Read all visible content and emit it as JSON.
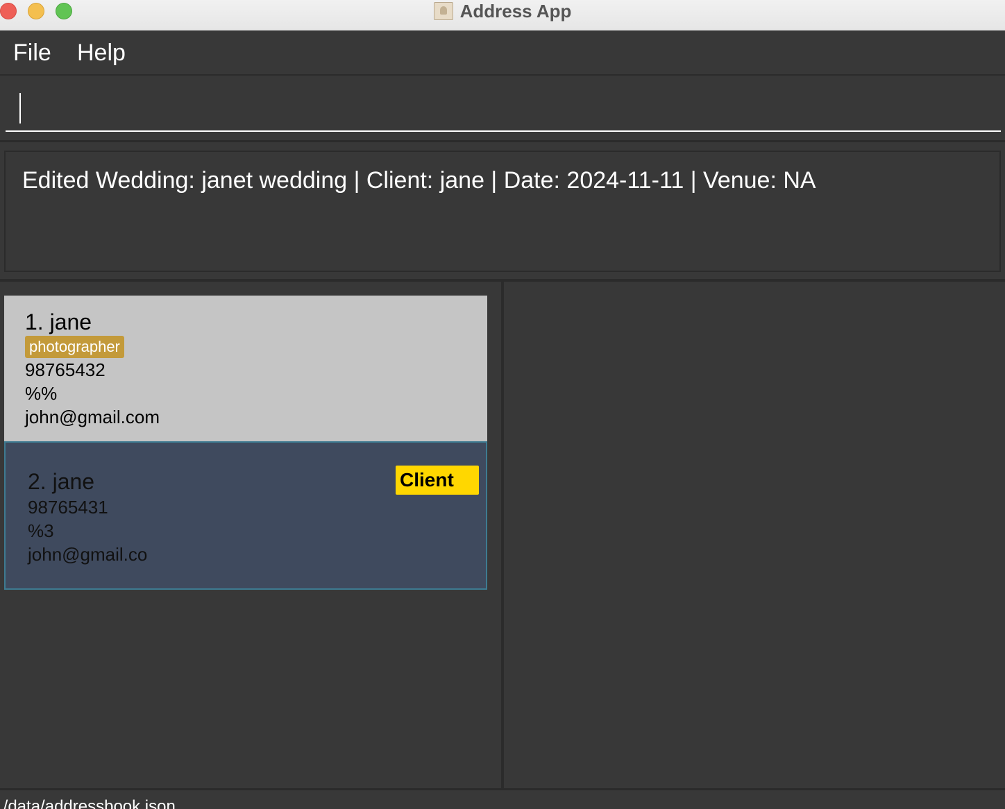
{
  "window": {
    "title": "Address App",
    "icon": "address-book-icon"
  },
  "menu": {
    "file": "File",
    "help": "Help"
  },
  "command": {
    "value": "",
    "placeholder": ""
  },
  "result": {
    "message": "Edited Wedding: janet wedding | Client: jane | Date: 2024-11-11 | Venue: NA"
  },
  "persons": [
    {
      "name": "1. jane",
      "role": "photographer",
      "phone": "98765432",
      "address": "%%",
      "email": "john@gmail.com"
    },
    {
      "name": "2. jane",
      "badge": "Client",
      "phone": "98765431",
      "address": "%3",
      "email": "john@gmail.co"
    }
  ],
  "status": {
    "path": "./data/addressbook.json"
  },
  "colors": {
    "background": "#383838",
    "card_selected": "#c5c5c5",
    "card_other": "#3f4a5e",
    "role_tag": "#c39a3a",
    "client_badge": "#ffd700"
  }
}
